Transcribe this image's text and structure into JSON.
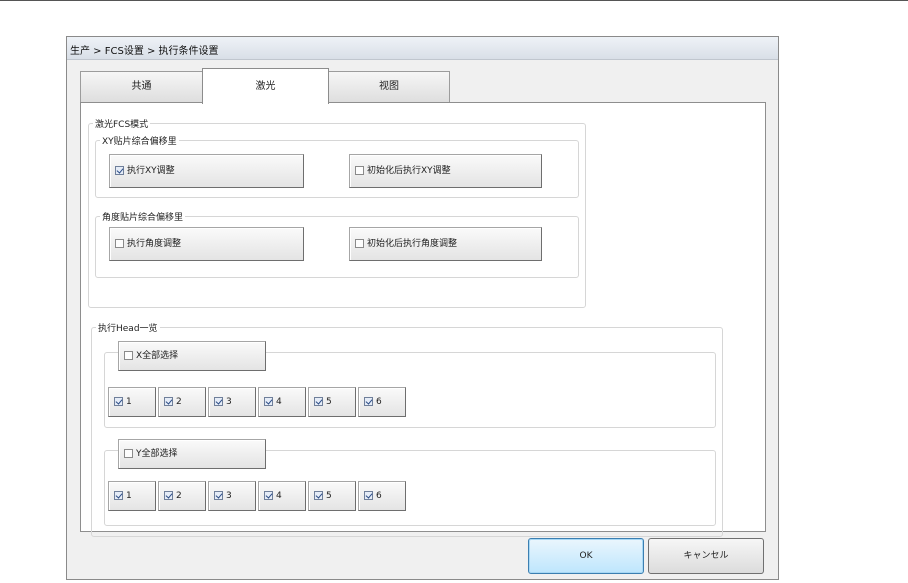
{
  "window": {
    "title": "生产 > FCS设置 > 执行条件设置"
  },
  "tabs": [
    {
      "label": "共通",
      "active": false
    },
    {
      "label": "激光",
      "active": true
    },
    {
      "label": "视图",
      "active": false
    }
  ],
  "laser_mode": {
    "label": "激光FCS模式",
    "xy_group": {
      "label": "XY贴片综合偏移里",
      "execute_adjust": {
        "label": "执行XY调整",
        "checked": true
      },
      "after_init": {
        "label": "初始化后执行XY调整",
        "checked": false
      }
    },
    "angle_group": {
      "label": "角度贴片综合偏移里",
      "execute_adjust": {
        "label": "执行角度调整",
        "checked": false
      },
      "after_init": {
        "label": "初始化后执行角度调整",
        "checked": false
      }
    }
  },
  "heads": {
    "label": "执行Head一览",
    "x_group": {
      "select_all": {
        "label": "X全部选择",
        "checked": false
      },
      "items": [
        {
          "label": "1",
          "checked": true
        },
        {
          "label": "2",
          "checked": true
        },
        {
          "label": "3",
          "checked": true
        },
        {
          "label": "4",
          "checked": true
        },
        {
          "label": "5",
          "checked": true
        },
        {
          "label": "6",
          "checked": true
        }
      ]
    },
    "y_group": {
      "select_all": {
        "label": "Y全部选择",
        "checked": false
      },
      "items": [
        {
          "label": "1",
          "checked": true
        },
        {
          "label": "2",
          "checked": true
        },
        {
          "label": "3",
          "checked": true
        },
        {
          "label": "4",
          "checked": true
        },
        {
          "label": "5",
          "checked": true
        },
        {
          "label": "6",
          "checked": true
        }
      ]
    }
  },
  "footer": {
    "ok_label": "OK",
    "cancel_label": "キャンセル"
  }
}
